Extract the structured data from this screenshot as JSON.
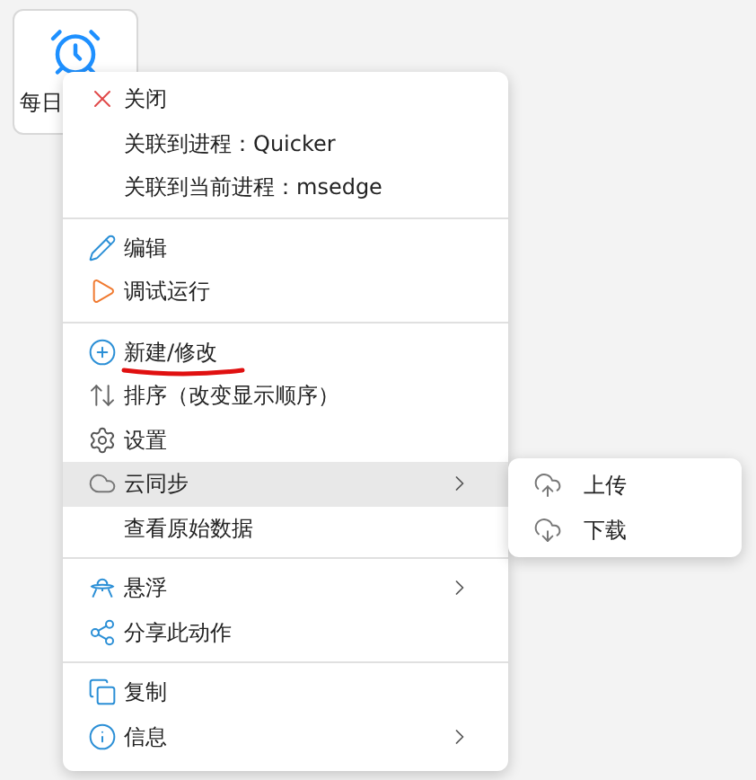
{
  "action_tile": {
    "label": "每日"
  },
  "context_menu": {
    "groups": [
      [
        {
          "label": "关闭",
          "selected": false,
          "submenu": false
        },
        {
          "label": "关联到进程：Quicker",
          "selected": false,
          "submenu": false
        },
        {
          "label": "关联到当前进程：msedge",
          "selected": false,
          "submenu": false
        }
      ],
      [
        {
          "label": "编辑",
          "selected": false,
          "submenu": false
        },
        {
          "label": "调试运行",
          "selected": false,
          "submenu": false
        }
      ],
      [
        {
          "label": "新建/修改",
          "selected": false,
          "submenu": false,
          "underlined": true
        },
        {
          "label": "排序（改变显示顺序）",
          "selected": false,
          "submenu": false
        },
        {
          "label": "设置",
          "selected": false,
          "submenu": false
        },
        {
          "label": "云同步",
          "selected": true,
          "submenu": true,
          "children": [
            {
              "label": "上传"
            },
            {
              "label": "下载"
            }
          ]
        },
        {
          "label": "查看原始数据",
          "selected": false,
          "submenu": false
        }
      ],
      [
        {
          "label": "悬浮",
          "selected": false,
          "submenu": true
        },
        {
          "label": "分享此动作",
          "selected": false,
          "submenu": false
        }
      ],
      [
        {
          "label": "复制",
          "selected": false,
          "submenu": false
        },
        {
          "label": "信息",
          "selected": false,
          "submenu": true
        }
      ]
    ]
  }
}
